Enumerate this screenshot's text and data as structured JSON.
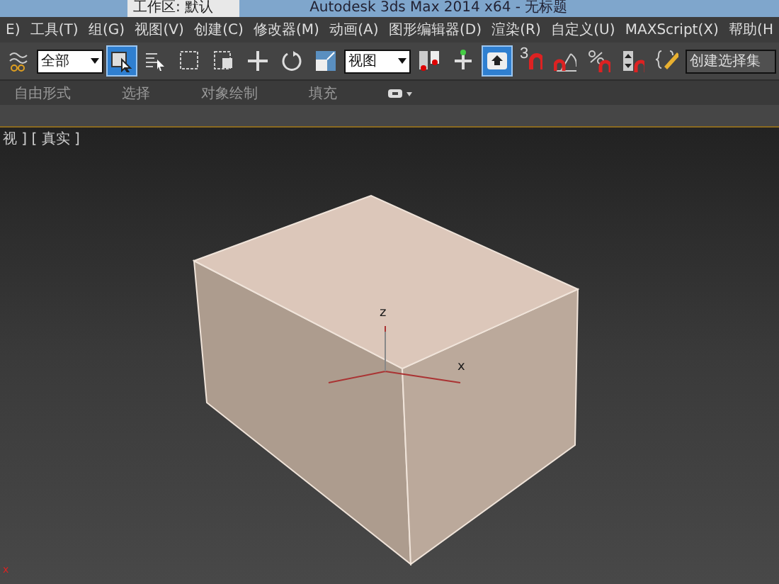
{
  "title_bar": {
    "workspace": "工作区: 默认",
    "title": "Autodesk 3ds Max  2014 x64  -  无标题"
  },
  "menu": [
    "E)",
    "工具(T)",
    "组(G)",
    "视图(V)",
    "创建(C)",
    "修改器(M)",
    "动画(A)",
    "图形编辑器(D)",
    "渲染(R)",
    "自定义(U)",
    "MAXScript(X)",
    "帮助(H"
  ],
  "toolbar": [
    {
      "kind": "link",
      "selected": false
    },
    {
      "kind": "dropdown",
      "value": "全部"
    },
    {
      "kind": "select",
      "selected": true
    },
    {
      "kind": "list",
      "selected": false
    },
    {
      "kind": "rect",
      "selected": false
    },
    {
      "kind": "window",
      "selected": false
    },
    {
      "kind": "move",
      "selected": false
    },
    {
      "kind": "rotate",
      "selected": false
    },
    {
      "kind": "scale",
      "selected": false
    },
    {
      "kind": "dropdown",
      "value": "视图"
    },
    {
      "kind": "pivot",
      "selected": false
    },
    {
      "kind": "axis",
      "selected": false
    },
    {
      "kind": "manip",
      "selected": true
    },
    {
      "kind": "snap",
      "label": "3",
      "selected": false
    },
    {
      "kind": "angle",
      "selected": false
    },
    {
      "kind": "percent",
      "selected": false
    },
    {
      "kind": "spinner",
      "selected": false
    },
    {
      "kind": "edit",
      "selected": false
    },
    {
      "kind": "combo",
      "placeholder": "创建选择集"
    }
  ],
  "ribbon_tabs": [
    "自由形式",
    "选择",
    "对象绘制",
    "填充"
  ],
  "viewport": {
    "label": "视 ] [ 真实 ]",
    "gizmo": {
      "z": "z",
      "x": "x"
    },
    "corner_axis": "x"
  }
}
